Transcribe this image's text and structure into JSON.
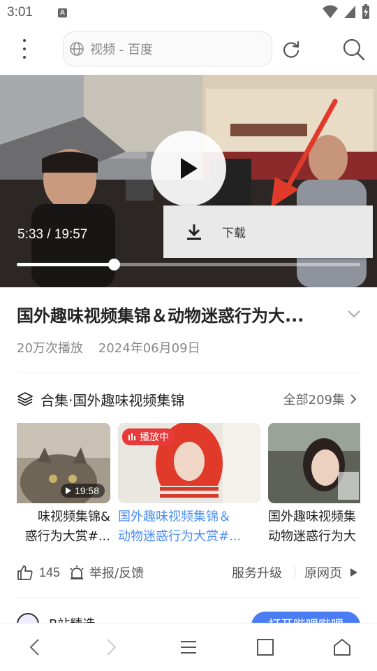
{
  "status_bar": {
    "time": "3:01",
    "notification_icon": "A"
  },
  "address_bar": {
    "url_text": "视频 - 百度"
  },
  "video": {
    "timecode": "5:33 / 19:57",
    "progress_fraction": 0.2833,
    "download_menu_label": "下载"
  },
  "info": {
    "title": "国外趣味视频集锦＆动物迷惑行为大...",
    "views": "20万次播放",
    "date": "2024年06月09日"
  },
  "collection": {
    "title": "合集·国外趣味视频集锦",
    "all_label": "全部209集",
    "cards": [
      {
        "title": "味视频集锦&\n惑行为大赏#...",
        "duration": "19:58"
      },
      {
        "title": "国外趣味视频集锦＆\n动物迷惑行为大赏#...",
        "badge": "播放中"
      },
      {
        "title": "国外趣味视频集\n动物迷惑行为大"
      }
    ]
  },
  "actions": {
    "like_count": "145",
    "report_label": "举报/反馈",
    "service_upgrade": "服务升级",
    "original_page": "原网页"
  },
  "source": {
    "name": "B站精选",
    "open_button": "打开哔哩哔哩"
  },
  "colors": {
    "accent_blue": "#4a8ef4",
    "playing_red": "#e83a3a"
  }
}
